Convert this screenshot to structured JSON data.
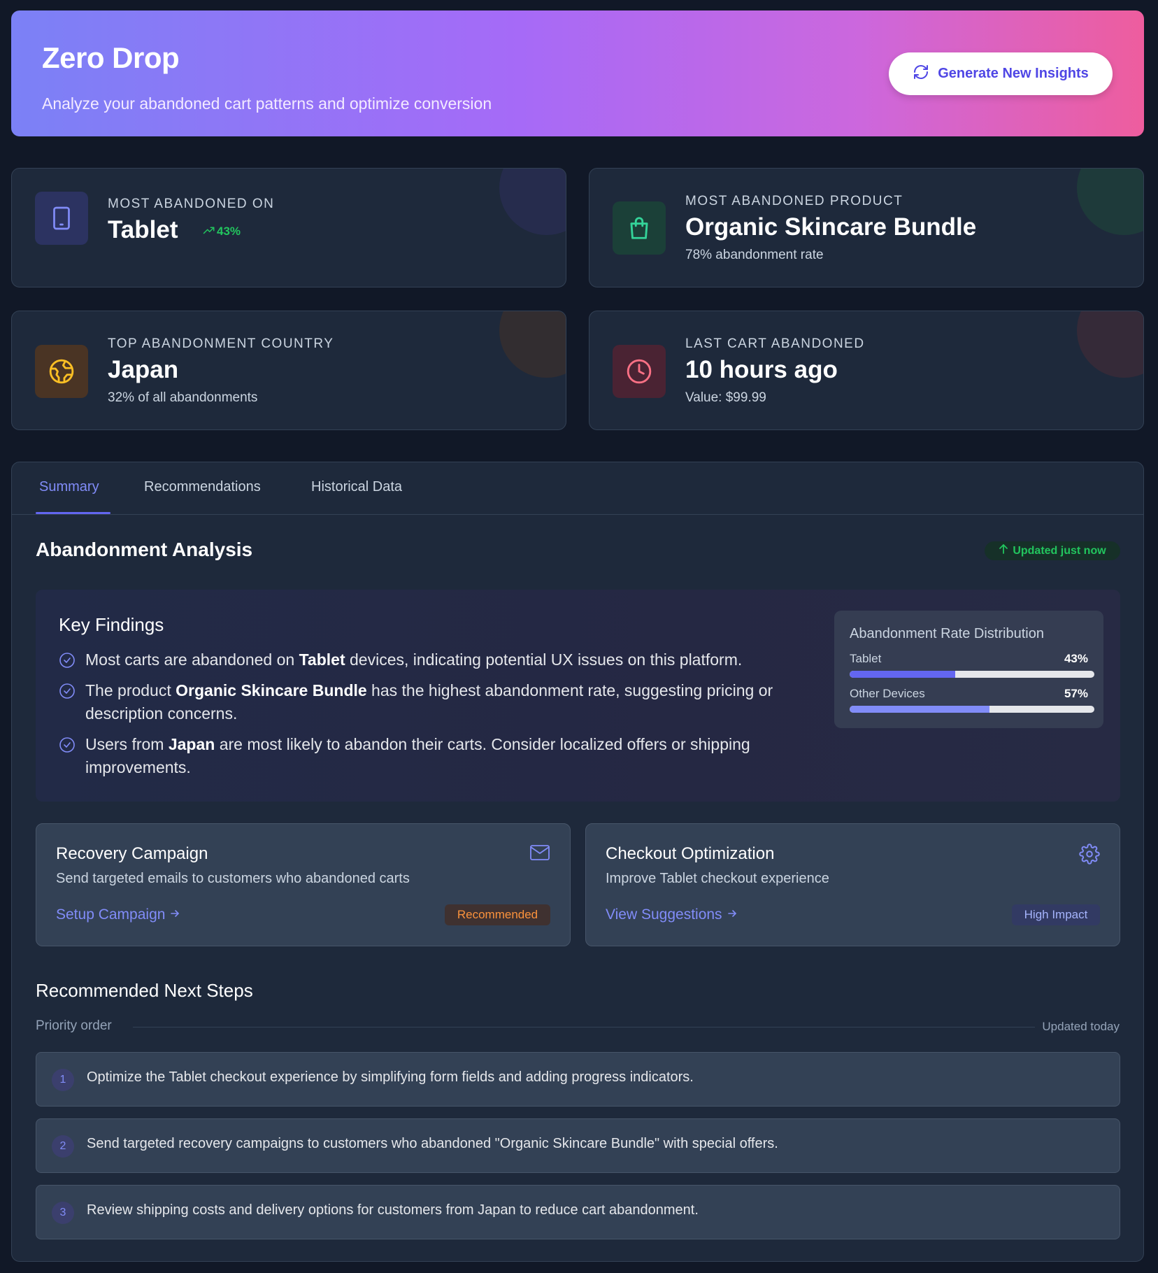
{
  "header": {
    "title": "Zero Drop",
    "subtitle": "Analyze your abandoned cart patterns and optimize conversion",
    "button_label": "Generate New Insights",
    "button_icon": "refresh-icon"
  },
  "stats": [
    {
      "label": "Most Abandoned On",
      "value": "Tablet",
      "trend": "43%",
      "icon": "tablet-icon",
      "accent": "#6366f1"
    },
    {
      "label": "Most Abandoned Product",
      "value": "Organic Skincare Bundle",
      "meta": "78% abandonment rate",
      "icon": "shopping-bag-icon",
      "accent": "#10b981"
    },
    {
      "label": "Top Abandonment Country",
      "value": "Japan",
      "meta": "32% of all abandonments",
      "icon": "globe-icon",
      "accent": "#f59e0b"
    },
    {
      "label": "Last Cart Abandoned",
      "value": "10 hours ago",
      "meta": "Value: $99.99",
      "icon": "clock-icon",
      "accent": "#f43f5e"
    }
  ],
  "tabs": [
    "Summary",
    "Recommendations",
    "Historical Data"
  ],
  "active_tab": "Summary",
  "analysis": {
    "title": "Abandonment Analysis",
    "updated": "Updated just now"
  },
  "findings": {
    "title": "Key Findings",
    "items": [
      {
        "pre": "Most carts are abandoned on ",
        "bold": "Tablet",
        "post": " devices, indicating potential UX issues on this platform."
      },
      {
        "pre": "The product ",
        "bold": "Organic Skincare Bundle",
        "post": " has the highest abandonment rate, suggesting pricing or description concerns."
      },
      {
        "pre": "Users from ",
        "bold": "Japan",
        "post": " are most likely to abandon their carts. Consider localized offers or shipping improvements."
      }
    ]
  },
  "distribution": {
    "title": "Abandonment Rate Distribution",
    "rows": [
      {
        "label": "Tablet",
        "value": "43%",
        "fraction": 0.43,
        "color": "#6366f1"
      },
      {
        "label": "Other Devices",
        "value": "57%",
        "fraction": 0.57,
        "color": "#818cf8"
      }
    ]
  },
  "actions": [
    {
      "title": "Recovery Campaign",
      "desc": "Send targeted emails to customers who abandoned carts",
      "link": "Setup Campaign",
      "badge": "Recommended",
      "icon": "mail-icon"
    },
    {
      "title": "Checkout Optimization",
      "desc": "Improve Tablet checkout experience",
      "link": "View Suggestions",
      "badge": "High Impact",
      "icon": "gear-icon"
    }
  ],
  "next_steps": {
    "title": "Recommended Next Steps",
    "priority_label": "Priority order",
    "updated": "Updated today",
    "items": [
      {
        "num": "1",
        "text": "Optimize the Tablet checkout experience by simplifying form fields and adding progress indicators."
      },
      {
        "num": "2",
        "text": "Send targeted recovery campaigns to customers who abandoned \"Organic Skincare Bundle\" with special offers."
      },
      {
        "num": "3",
        "text": "Review shipping costs and delivery options for customers from Japan to reduce cart abandonment."
      }
    ]
  }
}
